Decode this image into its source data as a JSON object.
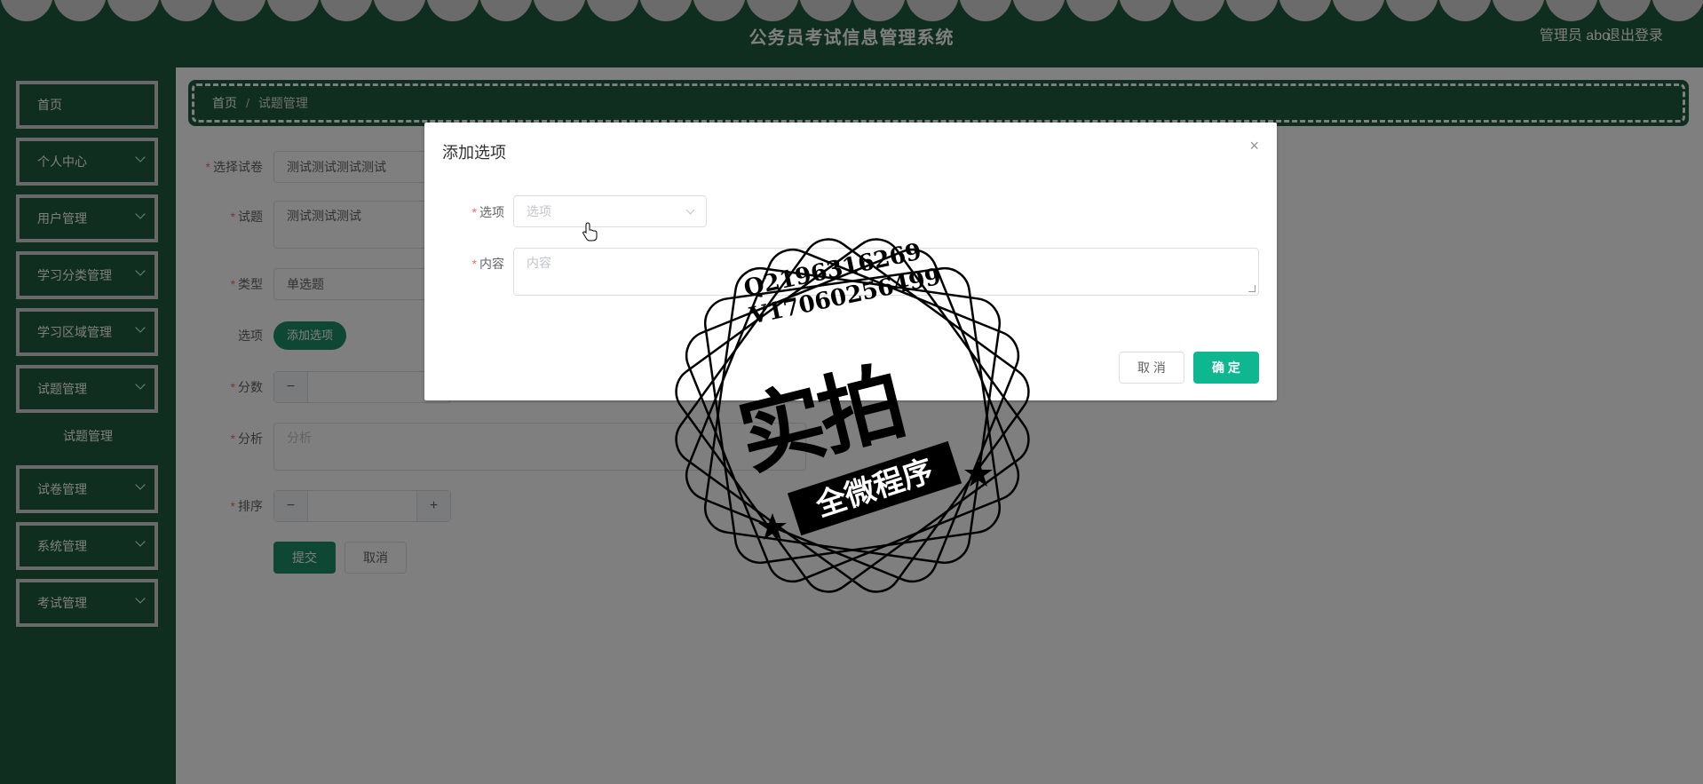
{
  "header": {
    "title": "公务员考试信息管理系统",
    "user": "管理员 abo",
    "logout": "退出登录"
  },
  "sidebar": {
    "items": [
      {
        "label": "首页",
        "expandable": false
      },
      {
        "label": "个人中心",
        "expandable": true
      },
      {
        "label": "用户管理",
        "expandable": true
      },
      {
        "label": "学习分类管理",
        "expandable": true
      },
      {
        "label": "学习区域管理",
        "expandable": true
      },
      {
        "label": "试题管理",
        "expandable": true
      },
      {
        "label": "试卷管理",
        "expandable": true
      },
      {
        "label": "系统管理",
        "expandable": true
      },
      {
        "label": "考试管理",
        "expandable": true
      }
    ],
    "submenu": {
      "label": "试题管理"
    }
  },
  "breadcrumb": {
    "home": "首页",
    "separator": "/",
    "current": "试题管理"
  },
  "form": {
    "paper_label": "选择试卷",
    "paper_value": "测试测试测试测试",
    "question_label": "试题",
    "question_value": "测试测试测试",
    "type_label": "类型",
    "type_value": "单选题",
    "options_label": "选项",
    "add_option_button": "添加选项",
    "score_label": "分数",
    "analysis_label": "分析",
    "analysis_placeholder": "分析",
    "order_label": "排序",
    "stepper_minus": "−",
    "stepper_plus": "+",
    "submit_button": "提交",
    "cancel_button": "取消"
  },
  "dialog": {
    "title": "添加选项",
    "close": "×",
    "option_label": "选项",
    "option_placeholder": "选项",
    "content_label": "内容",
    "content_placeholder": "内容",
    "cancel_button": "取 消",
    "confirm_button": "确 定"
  },
  "watermark": {
    "line1": "Q2196316269",
    "line2": "V17060256499",
    "big": "实拍",
    "banner": "全微程序"
  },
  "colors": {
    "primary_green": "#1f5c3f",
    "accent": "#0fb790",
    "required": "#f56c6c"
  }
}
